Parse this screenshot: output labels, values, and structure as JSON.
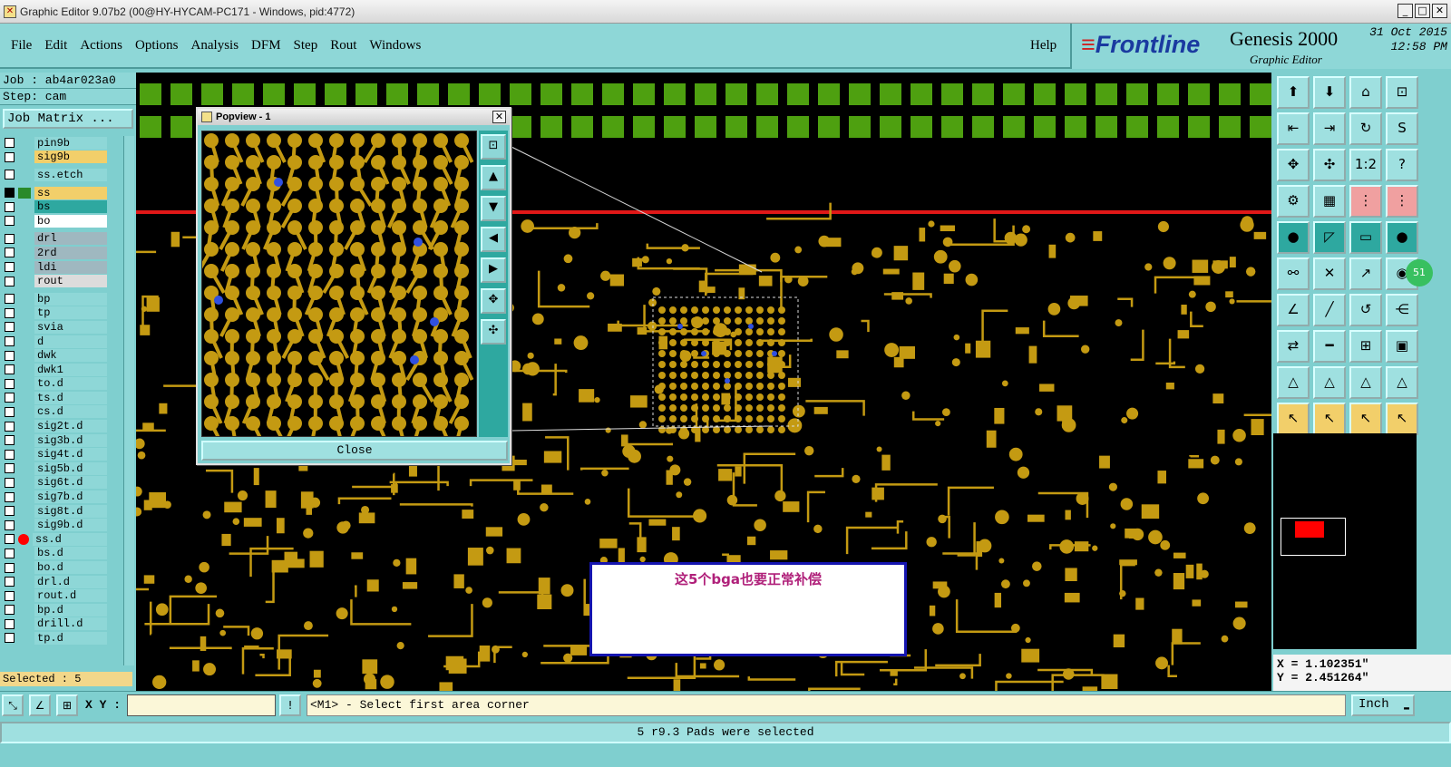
{
  "window": {
    "title": "Graphic Editor 9.07b2 (00@HY-HYCAM-PC171 - Windows, pid:4772)"
  },
  "menu": {
    "items": [
      "File",
      "Edit",
      "Actions",
      "Options",
      "Analysis",
      "DFM",
      "Step",
      "Rout",
      "Windows"
    ],
    "help": "Help"
  },
  "brand": {
    "logo_main": "Frontline",
    "product": "Genesis 2000",
    "subtitle": "Graphic Editor",
    "date": "31 Oct 2015",
    "time": "12:58 PM"
  },
  "job": {
    "job_line": "Job : ab4ar023a0",
    "step_line": "Step: cam",
    "matrix_button": "Job Matrix ..."
  },
  "layers": [
    {
      "name": "pin9b",
      "color": "#8ed7d7"
    },
    {
      "name": "sig9b",
      "color": "#f2cf6a"
    },
    {
      "name": "",
      "color": "#8ed7d7"
    },
    {
      "name": "ss.etch",
      "color": "#8ed7d7"
    },
    {
      "name": "",
      "color": "#8ed7d7"
    },
    {
      "name": "ss",
      "color": "#f2cf6a",
      "active": true
    },
    {
      "name": "bs",
      "color": "#2ea8a0"
    },
    {
      "name": "bo",
      "color": "#ffffff"
    },
    {
      "name": "",
      "color": "#8ed7d7"
    },
    {
      "name": "drl",
      "color": "#9fb8c0"
    },
    {
      "name": "2rd",
      "color": "#9fb8c0"
    },
    {
      "name": "ldi",
      "color": "#9fb8c0"
    },
    {
      "name": "rout",
      "color": "#dcdcdc"
    },
    {
      "name": "",
      "color": "#8ed7d7"
    },
    {
      "name": "bp",
      "color": "#8ed7d7"
    },
    {
      "name": "tp",
      "color": "#8ed7d7"
    },
    {
      "name": "svia",
      "color": "#8ed7d7"
    },
    {
      "name": "d",
      "color": "#8ed7d7"
    },
    {
      "name": "dwk",
      "color": "#8ed7d7"
    },
    {
      "name": "dwk1",
      "color": "#8ed7d7"
    },
    {
      "name": "to.d",
      "color": "#8ed7d7"
    },
    {
      "name": "ts.d",
      "color": "#8ed7d7"
    },
    {
      "name": "cs.d",
      "color": "#8ed7d7"
    },
    {
      "name": "sig2t.d",
      "color": "#8ed7d7"
    },
    {
      "name": "sig3b.d",
      "color": "#8ed7d7"
    },
    {
      "name": "sig4t.d",
      "color": "#8ed7d7"
    },
    {
      "name": "sig5b.d",
      "color": "#8ed7d7"
    },
    {
      "name": "sig6t.d",
      "color": "#8ed7d7"
    },
    {
      "name": "sig7b.d",
      "color": "#8ed7d7"
    },
    {
      "name": "sig8t.d",
      "color": "#8ed7d7"
    },
    {
      "name": "sig9b.d",
      "color": "#8ed7d7"
    },
    {
      "name": "ss.d",
      "color": "#8ed7d7",
      "dot": true
    },
    {
      "name": "bs.d",
      "color": "#8ed7d7"
    },
    {
      "name": "bo.d",
      "color": "#8ed7d7"
    },
    {
      "name": "drl.d",
      "color": "#8ed7d7"
    },
    {
      "name": "rout.d",
      "color": "#8ed7d7"
    },
    {
      "name": "bp.d",
      "color": "#8ed7d7"
    },
    {
      "name": "drill.d",
      "color": "#8ed7d7"
    },
    {
      "name": "tp.d",
      "color": "#8ed7d7"
    }
  ],
  "selected_status": "Selected : 5",
  "popview": {
    "title": "Popview - 1",
    "close_label": "Close"
  },
  "note": {
    "text": "这5个bga也要正常补偿"
  },
  "right_tools": {
    "icons": [
      "up-icon",
      "down-icon",
      "home-icon",
      "zoom-icon",
      "left-icon",
      "right-icon",
      "turn-icon",
      "s-icon",
      "fit-icon",
      "center-icon",
      "ratio-icon",
      "help-icon",
      "wrench-icon",
      "grid-icon",
      "traffic-icon",
      "traffic-icon",
      "pin-icon",
      "corner-icon",
      "ruler-icon",
      "dot-icon",
      "link-icon",
      "cross-icon",
      "slope-icon",
      "pad-icon",
      "angle-icon",
      "line-icon",
      "arc-icon",
      "ff-icon",
      "move-icon",
      "dash-icon",
      "fit-box-icon",
      "select-box-icon",
      "tri-icon",
      "tri-icon",
      "tri-icon",
      "tri-icon",
      "arrow-icon",
      "arrow-icon",
      "arrow-icon",
      "arrow-icon"
    ],
    "ratio_label": "1:2",
    "help_label": "?",
    "badge": "51"
  },
  "coords": {
    "x": "X = 1.102351\"",
    "y": "Y = 2.451264\""
  },
  "bottom": {
    "xy_label": "X Y :",
    "xy_value": "",
    "prompt": "<M1> - Select first area corner",
    "unit": "Inch"
  },
  "status": "5 r9.3 Pads were selected"
}
